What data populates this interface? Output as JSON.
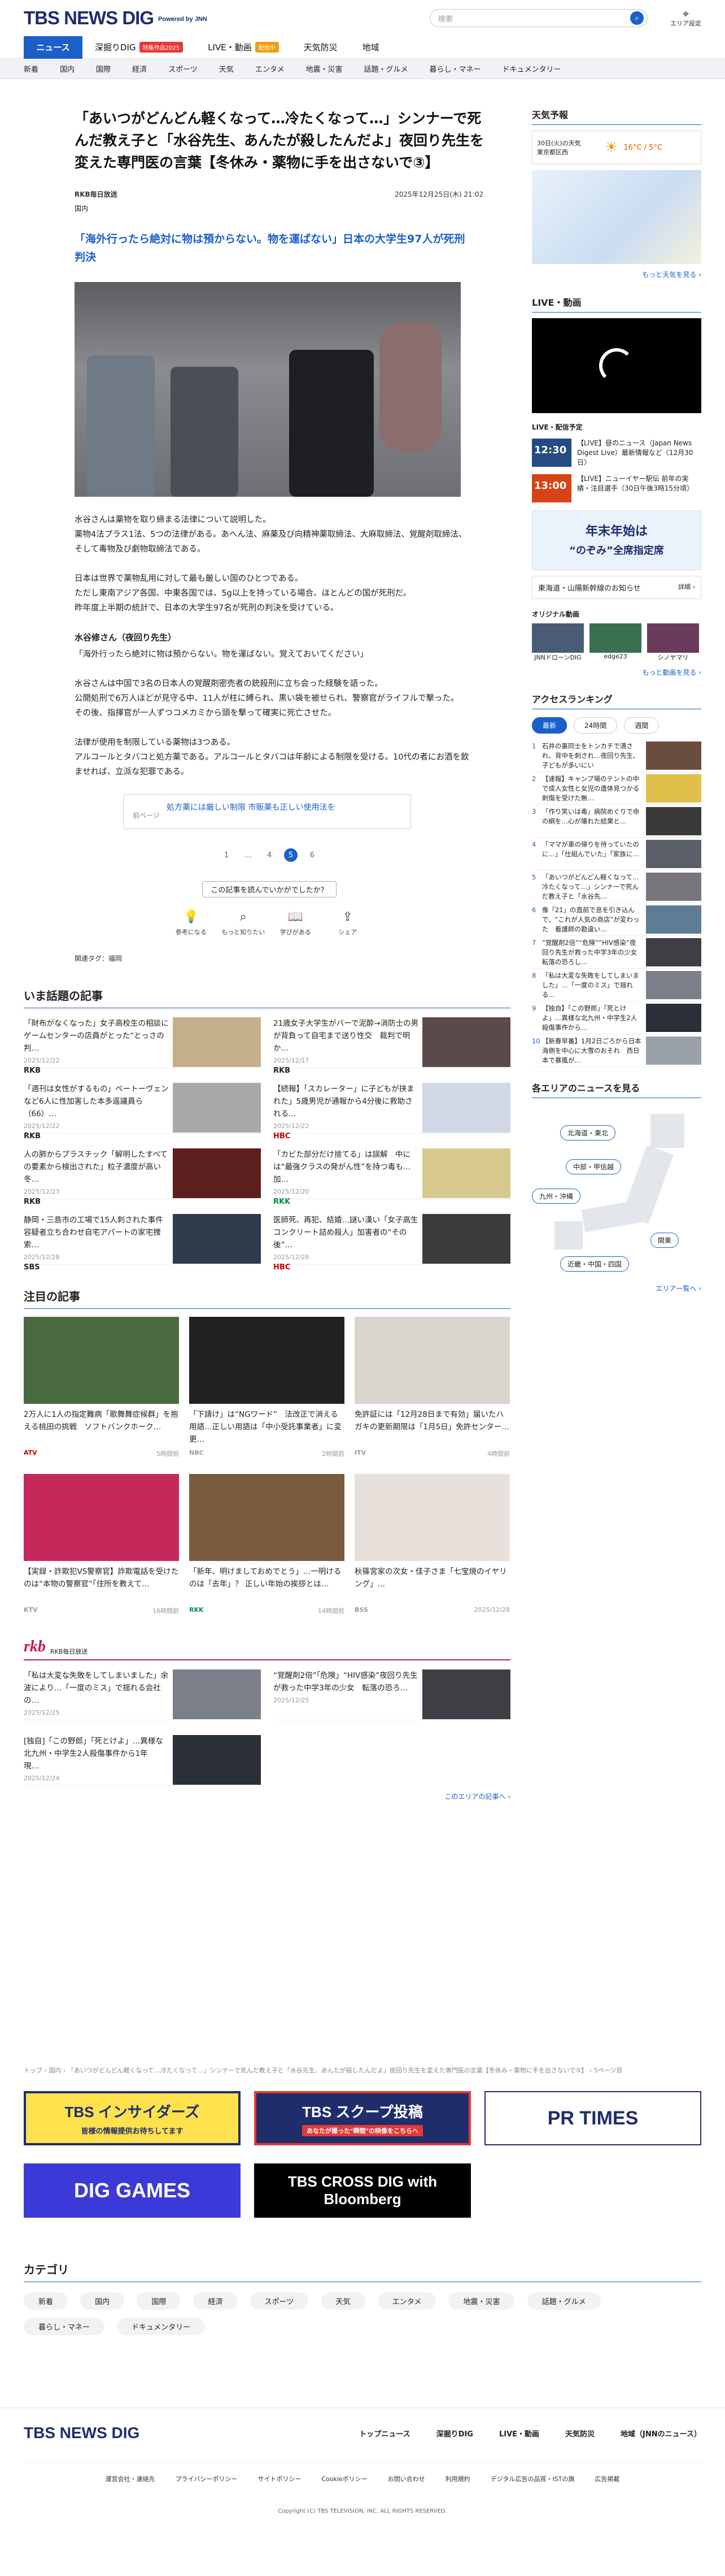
{
  "header": {
    "logo": "TBS NEWS DIG",
    "powered": "Powered by JNN",
    "search_placeholder": "検索",
    "search_icon": "search-icon",
    "area_label": "エリア設定"
  },
  "gnav": [
    {
      "label": "ニュース"
    },
    {
      "label": "深掘りDIG",
      "badge": "特集作品2025",
      "badge_color": "#e53935"
    },
    {
      "label": "LIVE・動画",
      "badge": "配信中",
      "badge_color": "#f39c12"
    },
    {
      "label": "天気防災"
    },
    {
      "label": "地域"
    }
  ],
  "subnav": [
    "新着",
    "国内",
    "国際",
    "経済",
    "スポーツ",
    "天気",
    "エンタメ",
    "地震・災害",
    "話題・グルメ",
    "暮らし・マネー",
    "ドキュメンタリー"
  ],
  "article": {
    "title": "「あいつがどんどん軽くなって…冷たくなって…」シンナーで死んだ教え子と「水谷先生、あんたが殺したんだよ」夜回り先生を変えた専門医の言葉【冬休み・薬物に手を出さないで③】",
    "source": "RKB毎日放送",
    "date": "2025年12月25日(木) 21:02",
    "category": "国内",
    "lead": "「海外行ったら絶対に物は預からない。物を運ばない」日本の大学生97人が死刑判決",
    "paragraphs": [
      "水谷さんは薬物を取り締まる法律について説明した。\n薬物4法プラス1法、5つの法律がある。あへん法、麻薬及び向精神薬取締法、大麻取締法、覚醒剤取締法、そして毒物及び劇物取締法である。",
      "日本は世界で薬物乱用に対して最も厳しい国のひとつである。\nただし東南アジア各国、中東各国では、5g以上を持っている場合、ほとんどの国が死刑だ。\n昨年度上半期の統計で、日本の大学生97名が死刑の判決を受けている。"
    ],
    "subhead": "水谷修さん（夜回り先生）",
    "quote": "「海外行ったら絶対に物は預からない。物を運ばない。覚えておいてください」",
    "paragraphs2": [
      "水谷さんは中国で3名の日本人の覚醒剤密売者の銃殺刑に立ち会った経験を語った。\n公開処刑で6万人ほどが見守る中、11人が柱に縛られ、黒い袋を被せられ、警察官がライフルで撃った。\nその後、指揮官が一人ずつコメカミから頭を撃って確実に死亡させた。",
      "法律が使用を制限している薬物は3つある。\nアルコールとタバコと処方薬である。アルコールとタバコは年齢による制限を受ける。10代の者にお酒を飲ませれば、立派な犯罪である。"
    ],
    "related_label": "前ページ",
    "related_link": "処方薬には厳しい制限 市販薬も正しい使用法を",
    "pages": [
      "1",
      "…",
      "4",
      "5",
      "6"
    ],
    "current_page": "5",
    "reaction_q": "この記事を読んでいかがでしたか？",
    "reactions": [
      "参考になる",
      "もっと知りたい",
      "学びがある",
      "シェア"
    ],
    "tags_label": "関連タグ：",
    "tags": "福岡"
  },
  "trending": {
    "heading": "いま話題の記事",
    "items": [
      {
        "title": "「財布がなくなった」女子高校生の相談にゲームセンターの店員がとった“とっさの判…",
        "date": "2025/12/22",
        "src": "RKB"
      },
      {
        "title": "21歳女子大学生がバーで泥酔→消防士の男が背負って自宅まで送り性交　裁判で明か…",
        "date": "2025/12/17",
        "src": "RKB"
      },
      {
        "title": "「週刊は女性がするもの」ベートーヴェンなど6人に性加害した本多遥議員ら（66）…",
        "date": "2025/12/22",
        "src": "RKB"
      },
      {
        "title": "【続報】「スカレーター」に子どもが挟まれた」5歳男児が通報から4分後に救助される…",
        "date": "2025/12/22",
        "src": "HBC"
      },
      {
        "title": "人の肺からプラスチック「解明したすべての要素から検出された」粒子濃度が高い冬…",
        "date": "2025/12/23",
        "src": "RKB"
      },
      {
        "title": "「カビた部分だけ捨てる」は誤解　中には“最強クラスの発がん性”を持つ毒も…加…",
        "date": "2025/12/20",
        "src": "RKK"
      },
      {
        "title": "静岡・三島市の工場で15人刺された事件　容疑者立ち合わせ自宅アパートの家宅捜索…",
        "date": "2025/12/28",
        "src": "SBS"
      },
      {
        "title": "医師死、再犯、結婚…謎い漢い「女子高生コンクリート詰め殺人」加害者の“その後”…",
        "date": "2025/12/28",
        "src": "HBC"
      }
    ]
  },
  "featured": {
    "heading": "注目の記事",
    "items": [
      {
        "title": "2万人に1人の指定難病「歌舞舞症候群」を抱える桃田の挑戦　ソフトバンクホーク…",
        "date": "5時間前",
        "src": "ATV"
      },
      {
        "title": "「下請け」は“NGワード”　法改正で消える用語…正しい用語は「中小受託事業者」に変更…",
        "date": "2時間前",
        "src": "NBC"
      },
      {
        "title": "免許証には「12月28日まで有効」届いたハガキの更新期限は「1月5日」免許センター…",
        "date": "4時間前",
        "src": "ITV"
      },
      {
        "title": "【実録・詐欺犯VS警察官】詐欺電話を受けたのは“本物の警察官”「住所を教えて…",
        "date": "16時間前",
        "src": "KTV"
      },
      {
        "title": "「新年、明けましておめでとう」…一明けるのは「去年」？ 正しい年始の挨拶とは…",
        "date": "14時間前",
        "src": "RKK"
      },
      {
        "title": "秋篠宮家の次女・佳子さま「七宝焼のイヤリング」…",
        "date": "2025/12/28",
        "src": "BSS"
      }
    ]
  },
  "rkb": {
    "logo": "rkb",
    "name": "RKB毎日放送",
    "items": [
      {
        "title": "「私は大変な失敗をしてしまいました」余波により…「一度のミス」で揺れる会社の…",
        "date": "2025/12/25"
      },
      {
        "title": "“覚醒剤2倍”「危険」“HIV感染”夜回り先生が救った中学3年の少女　転落の恐ろ…",
        "date": "2025/12/25"
      },
      {
        "title": "[独自]「この野郎」「死とけよ」…異様な北九州・中学生2人殺傷事件から1年　現…",
        "date": "2025/12/24"
      }
    ],
    "more": "このエリアの記事へ ›"
  },
  "breadcrumb": "トップ › 国内 › 「あいつがどんどん軽くなって…冷たくなって…」シンナーで死んだ教え子と「水谷先生、あんたが殺したんだよ」夜回り先生を変えた専門医の言葉【冬休み・薬物に手を出さないで③】 › 5ページ目",
  "banners": [
    {
      "label": "TBS インサイダーズ",
      "sub": "皆様の情報提供お待ちしてます",
      "bg": "#ffe14d"
    },
    {
      "label": "TBS スクープ投稿",
      "sub": "あなたが撮った“瞬間”の映像をこちらへ",
      "bg": "#1f2d6b"
    },
    {
      "label": "PR TIMES",
      "bg": "#ffffff"
    },
    {
      "label": "DIG GAMES",
      "bg": "#3b3ad8"
    },
    {
      "label": "TBS CROSS DIG with Bloomberg",
      "bg": "#000000"
    }
  ],
  "categories": {
    "heading": "カテゴリ",
    "items": [
      "新着",
      "国内",
      "国際",
      "経済",
      "スポーツ",
      "天気",
      "エンタメ",
      "地震・災害",
      "話題・グルメ",
      "暮らし・マネー",
      "ドキュメンタリー"
    ]
  },
  "footer": {
    "logo": "TBS NEWS DIG",
    "nav": [
      "トップニュース",
      "深掘りDIG",
      "LIVE・動画",
      "天気防災",
      "地域（JNNのニュース）"
    ],
    "links": [
      "運営会社・連絡先",
      "プライバシーポリシー",
      "サイトポリシー",
      "Cookieポリシー",
      "お問い合わせ",
      "利用規約",
      "デジタル広告の品質・ISTの旗",
      "広告掲載"
    ],
    "copyright": "Copyright (C) TBS TELEVISION, INC. ALL RIGHTS RESERVED."
  },
  "sidebar": {
    "weather_heading": "天気予報",
    "weather_day": "30日(火)の天気",
    "weather_place": "東京都区西",
    "weather_temp": "16°C / 5°C",
    "weather_more": "もっと天気を見る ›",
    "live_heading": "LIVE・動画",
    "live_sched": "LIVE・配信予定",
    "live_items": [
      {
        "time": "12:30",
        "title": "【LIVE】昼のニュース（Japan News Digest Live）最新情報など〈12月30日〉"
      },
      {
        "time": "13:00",
        "title": "【LIVE】ニューイヤー駅伝 前年の実績・注目選手（30日午後3時15分頃）"
      }
    ],
    "ad_title": "年末年始は",
    "ad_sub": "“のぞみ”全席指定席",
    "ad_caption": "東海道・山陽新幹線のお知らせ",
    "ad_detail": "詳細 ›",
    "orig_heading": "オリジナル動画",
    "orig_items": [
      "JNNドローンDIG",
      "edge23",
      "シノヤマリ"
    ],
    "video_more": "もっと動画を見る ›",
    "rank_heading": "アクセスランキング",
    "rank_tabs": [
      "最新",
      "24時間",
      "週間"
    ],
    "ranks": [
      "石井の裏同士をトンカチで潰され、背中を刺され…夜回り先生、子どもが多いにい",
      "【速報】キャンプ場のテントの中で成人女性と女児の遺体見つかる　刺傷を受けた無…",
      "「作り笑いは毒」病院めぐりで命の綱を…心が壊れた結果と…",
      "「ママが車の帰りを待っていたのに…」「仕組んでいた」「家族に…",
      "「あいつがどんどん軽くなって…冷たくなって…」シンナーで死んだ教え子と「水谷先…",
      "像「21」の直前で息を引き込んで、“これが人気の商店”が変わった　看護師の勘違い…",
      "“覚醒剤2倍”“危険”“HIV感染”夜回り先生が救った中学3年の少女　転落の恐ろし…",
      "「私は大変な失敗をしてしまいました」…「一度のミス」で揺れる…",
      "【独自】「この野郎」「死とけよ」…異様な北九州・中学生2人殺傷事件から…",
      "【新春早番】1月2日ごろから日本海側を中心に大雪のおそれ　西日本で暴風が…"
    ],
    "area_heading": "各エリアのニュースを見る",
    "areas": [
      "北海道・東北",
      "中部・甲信越",
      "九州・沖縄",
      "関東",
      "近畿・中国・四国"
    ],
    "area_more": "エリア一覧へ ›"
  }
}
